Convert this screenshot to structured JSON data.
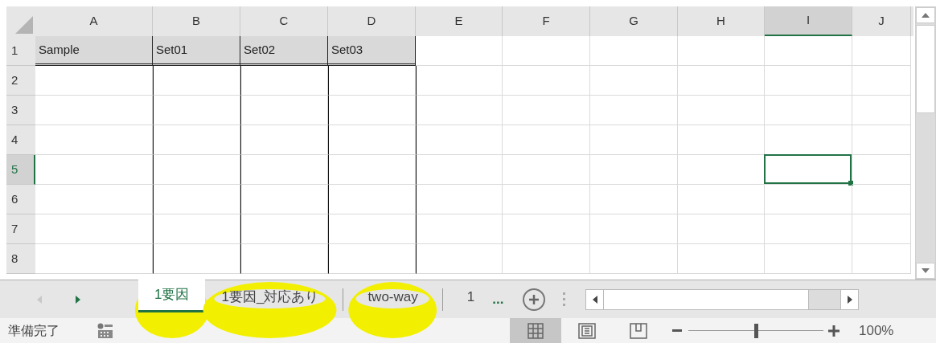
{
  "columns": [
    {
      "label": "A",
      "selected": false
    },
    {
      "label": "B",
      "selected": false
    },
    {
      "label": "C",
      "selected": false
    },
    {
      "label": "D",
      "selected": false
    },
    {
      "label": "E",
      "selected": false
    },
    {
      "label": "F",
      "selected": false
    },
    {
      "label": "G",
      "selected": false
    },
    {
      "label": "H",
      "selected": false
    },
    {
      "label": "I",
      "selected": true
    },
    {
      "label": "J",
      "selected": false
    }
  ],
  "rows": [
    {
      "label": "1",
      "selected": false,
      "cells": [
        "Sample",
        "Set01",
        "Set02",
        "Set03"
      ]
    },
    {
      "label": "2",
      "selected": false,
      "cells": []
    },
    {
      "label": "3",
      "selected": false,
      "cells": []
    },
    {
      "label": "4",
      "selected": false,
      "cells": []
    },
    {
      "label": "5",
      "selected": true,
      "cells": []
    },
    {
      "label": "6",
      "selected": false,
      "cells": []
    },
    {
      "label": "7",
      "selected": false,
      "cells": []
    },
    {
      "label": "8",
      "selected": false,
      "cells": []
    }
  ],
  "sheet_tabs": [
    {
      "label": "1要因",
      "selected": true,
      "highlighted": true
    },
    {
      "label": "1要因_対応あり",
      "selected": false,
      "highlighted": true
    },
    {
      "label": "two-way",
      "selected": false,
      "highlighted": true
    },
    {
      "label": "1",
      "selected": false,
      "highlighted": false
    }
  ],
  "more_tabs": "...",
  "status": "準備完了",
  "views": [
    {
      "kind": "normal",
      "selected": true
    },
    {
      "kind": "page-layout",
      "selected": false
    },
    {
      "kind": "page-break",
      "selected": false
    }
  ],
  "zoom": {
    "level": 0.5,
    "reading": "100%"
  }
}
